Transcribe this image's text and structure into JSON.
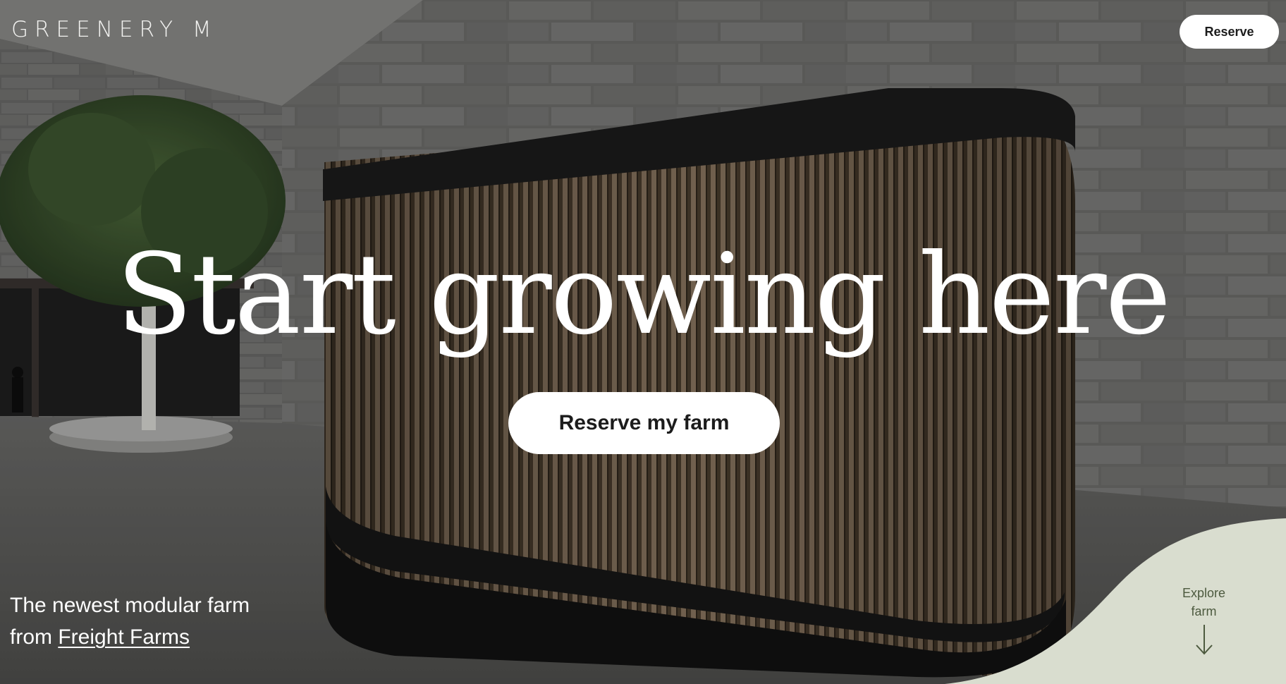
{
  "brand": {
    "logo_text": "GREENERY M"
  },
  "header": {
    "reserve_label": "Reserve"
  },
  "hero": {
    "title": "Start growing here",
    "cta_label": "Reserve my farm"
  },
  "tagline": {
    "line1": "The newest modular farm",
    "line2_prefix": "from ",
    "link_text": "Freight Farms"
  },
  "explore": {
    "line1": "Explore",
    "line2": "farm",
    "arrow_icon": "arrow-down-icon"
  },
  "colors": {
    "blob": "#d9ddcf",
    "explore_text": "#4d5a3f",
    "button_bg": "#ffffff",
    "button_text": "#1c1c1c"
  }
}
